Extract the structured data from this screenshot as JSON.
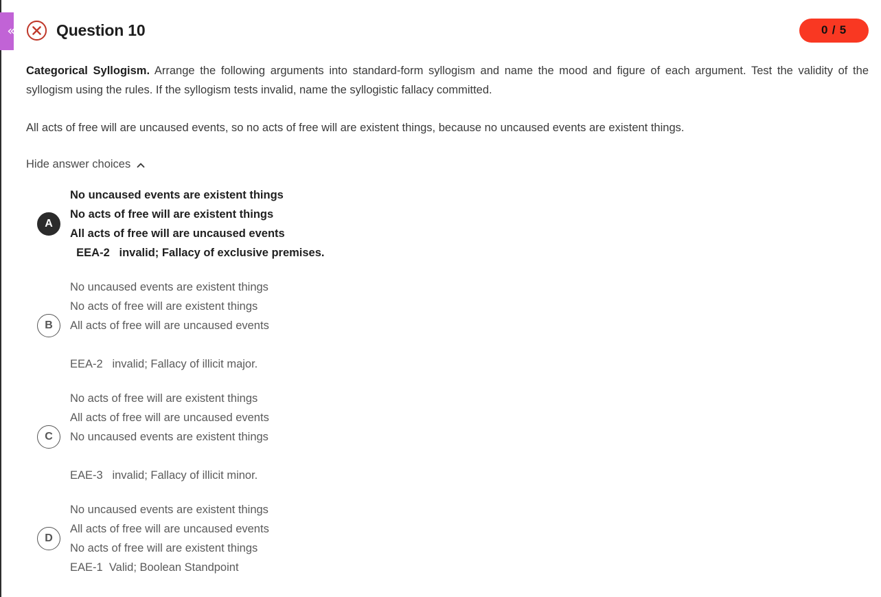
{
  "side_handle": {
    "icon": "chevron-left-icon",
    "glyph": "«",
    "color": "#c163d6"
  },
  "header": {
    "status_icon": "circle-x-icon",
    "status_icon_color": "#c0392b",
    "title": "Question 10",
    "score_badge": {
      "text": "0 / 5",
      "background": "#f93822",
      "text_color": "#111111"
    }
  },
  "question": {
    "prompt_label": "Categorical Syllogism.",
    "prompt_body": " Arrange the following arguments into standard-form syllogism and name the mood and figure of each argument. Test the validity of the syllogism using the rules. If the syllogism tests invalid, name the syllogistic fallacy committed.",
    "argument": "All acts of free will are uncaused events, so no acts of free will are existent things, because no uncaused events are existent things."
  },
  "toggle": {
    "label": "Hide answer choices",
    "icon": "chevron-up-icon"
  },
  "choices": [
    {
      "letter": "A",
      "selected": true,
      "text": "No uncaused events are existent things\nNo acts of free will are existent things\nAll acts of free will are uncaused events\n  EEA-2   invalid; Fallacy of exclusive premises."
    },
    {
      "letter": "B",
      "selected": false,
      "text": "No uncaused events are existent things\nNo acts of free will are existent things\nAll acts of free will are uncaused events\n\nEEA-2   invalid; Fallacy of illicit major."
    },
    {
      "letter": "C",
      "selected": false,
      "text": "No acts of free will are existent things\nAll acts of free will are uncaused events\nNo uncaused events are existent things\n\nEAE-3   invalid; Fallacy of illicit minor."
    },
    {
      "letter": "D",
      "selected": false,
      "text": "No uncaused events are existent things\nAll acts of free will are uncaused events\nNo acts of free will are existent things\nEAE-1  Valid; Boolean Standpoint"
    }
  ]
}
